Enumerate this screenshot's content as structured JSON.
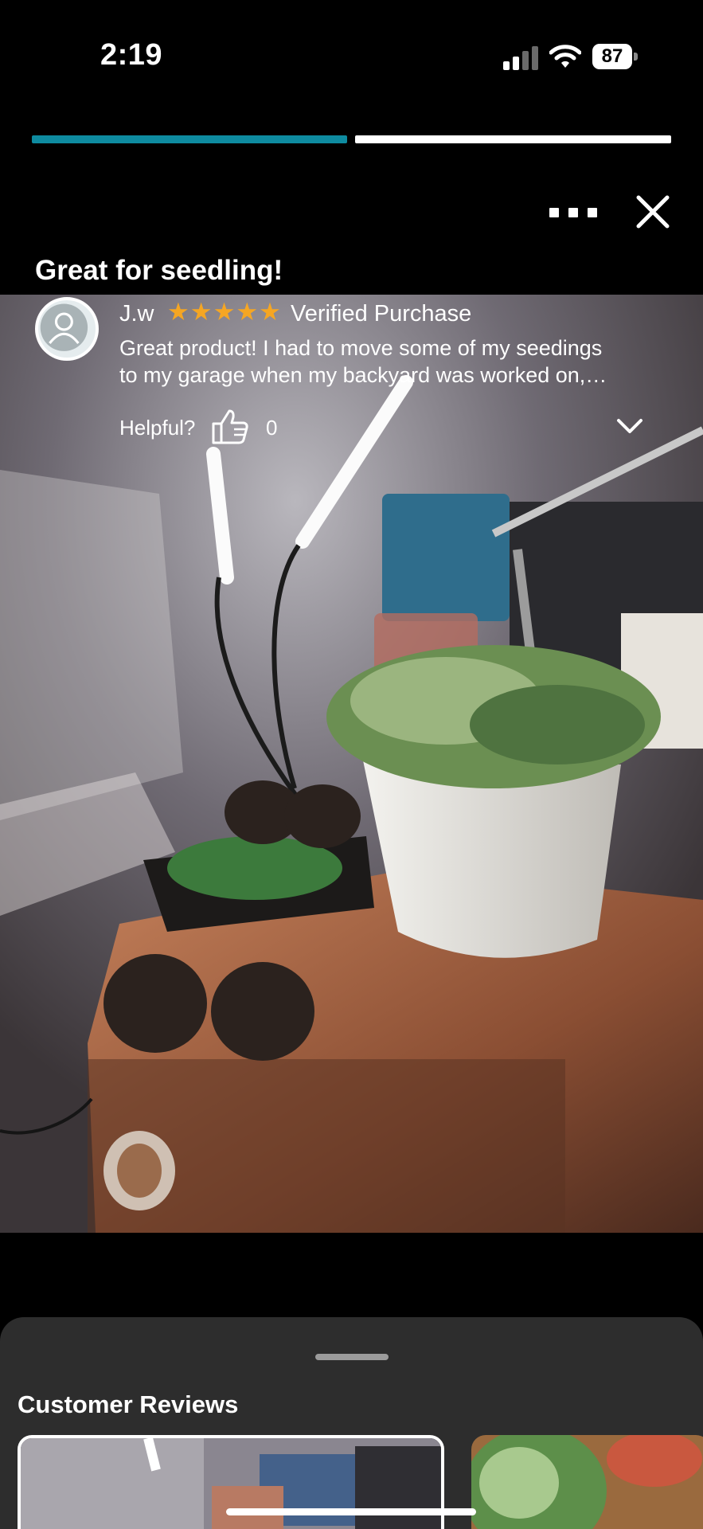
{
  "status_bar": {
    "time": "2:19",
    "battery": "87",
    "icons": [
      "cellular-signal-icon",
      "wifi-icon",
      "battery-icon"
    ]
  },
  "story_progress": {
    "segments": 2,
    "active_segment": 1,
    "active_color": "#0e8ba0",
    "inactive_color": "#ffffff"
  },
  "top_controls": {
    "icons": [
      "more-options-icon",
      "close-icon"
    ]
  },
  "review": {
    "title": "Great for seedling!",
    "reviewer": "J.w",
    "rating_stars": "★★★★★",
    "rating": 5,
    "verified_label": "Verified Purchase",
    "text_line_1": "Great product! I had to move some of my seedings",
    "text_line_2": "to my garage when my backyard was worked on,…",
    "helpful_label": "Helpful?",
    "helpful_count": "0",
    "star_color": "#f5a623"
  },
  "photo": {
    "icon": "review-photo-image"
  },
  "bottom_sheet": {
    "title": "Customer Reviews",
    "background": "#2d2d2d"
  }
}
